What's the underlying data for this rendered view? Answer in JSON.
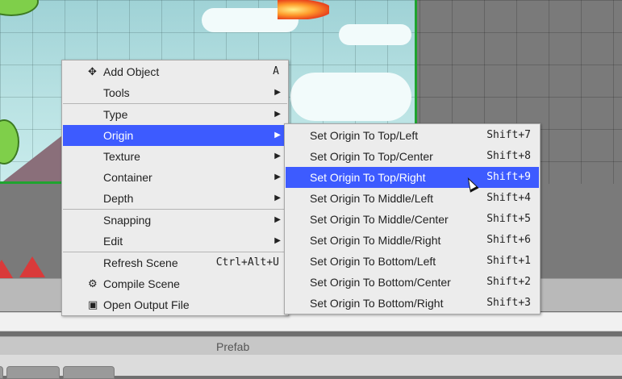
{
  "main_menu": {
    "items": [
      {
        "label": "Add Object",
        "shortcut": "A",
        "icon": "plus-move-icon"
      },
      {
        "label": "Tools",
        "submenu": true
      },
      {
        "label": "Type",
        "submenu": true
      },
      {
        "label": "Origin",
        "submenu": true,
        "highlighted": true
      },
      {
        "label": "Texture",
        "submenu": true
      },
      {
        "label": "Container",
        "submenu": true
      },
      {
        "label": "Depth",
        "submenu": true
      },
      {
        "label": "Snapping",
        "submenu": true
      },
      {
        "label": "Edit",
        "submenu": true
      },
      {
        "label": "Refresh Scene",
        "shortcut": "Ctrl+Alt+U"
      },
      {
        "label": "Compile Scene",
        "icon": "gear-icon"
      },
      {
        "label": "Open Output File",
        "icon": "file-image-icon"
      }
    ],
    "arrow": "▶",
    "icons": {
      "add": "✥",
      "compile": "⚙",
      "file": "▣"
    }
  },
  "origin_submenu": {
    "items": [
      {
        "label": "Set Origin To Top/Left",
        "shortcut": "Shift+7"
      },
      {
        "label": "Set Origin To Top/Center",
        "shortcut": "Shift+8"
      },
      {
        "label": "Set Origin To Top/Right",
        "shortcut": "Shift+9",
        "highlighted": true
      },
      {
        "label": "Set Origin To Middle/Left",
        "shortcut": "Shift+4"
      },
      {
        "label": "Set Origin To Middle/Center",
        "shortcut": "Shift+5"
      },
      {
        "label": "Set Origin To Middle/Right",
        "shortcut": "Shift+6"
      },
      {
        "label": "Set Origin To Bottom/Left",
        "shortcut": "Shift+1"
      },
      {
        "label": "Set Origin To Bottom/Center",
        "shortcut": "Shift+2"
      },
      {
        "label": "Set Origin To Bottom/Right",
        "shortcut": "Shift+3"
      }
    ]
  },
  "bottom_panel": {
    "prefab_label": "Prefab"
  },
  "colors": {
    "highlight": "#3d5bff",
    "scene_border": "#1fa32f"
  }
}
